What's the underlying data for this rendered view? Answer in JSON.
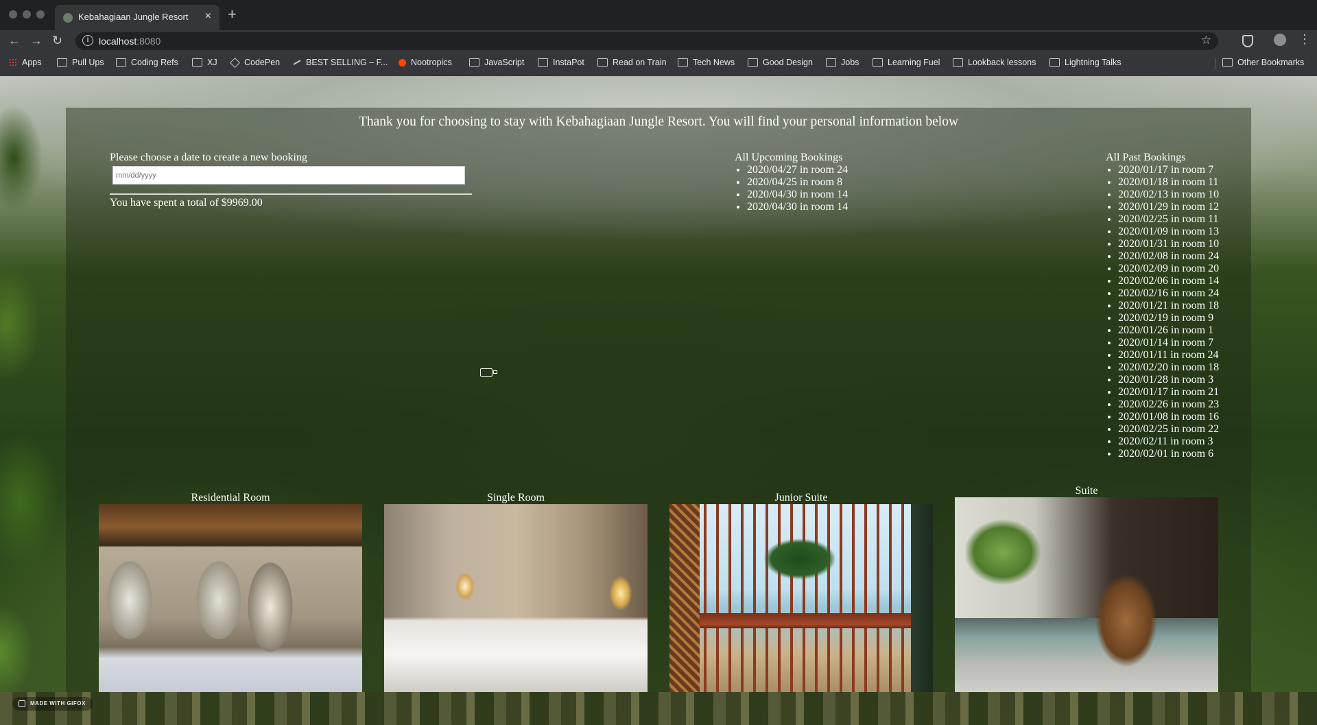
{
  "browser": {
    "tab_title": "Kebahagiaan Jungle Resort",
    "tab_close": "×",
    "new_tab": "+",
    "url_host": "localhost",
    "url_port": ":8080",
    "back": "←",
    "forward": "→",
    "reload": "↻",
    "star": "☆",
    "menu": "⋮",
    "info": "i"
  },
  "bookmarks": [
    {
      "label": "Apps",
      "icon": "apps-grid-icon"
    },
    {
      "label": "Pull Ups",
      "icon": "folder-icon"
    },
    {
      "label": "Coding Refs",
      "icon": "folder-icon"
    },
    {
      "label": "XJ",
      "icon": "folder-icon"
    },
    {
      "label": "CodePen",
      "icon": "codepen-icon"
    },
    {
      "label": "BEST SELLING – F...",
      "icon": "pen-icon"
    },
    {
      "label": "Nootropics",
      "icon": "reddit-icon"
    },
    {
      "label": "JavaScript",
      "icon": "folder-icon"
    },
    {
      "label": "InstaPot",
      "icon": "folder-icon"
    },
    {
      "label": "Read on Train",
      "icon": "folder-icon"
    },
    {
      "label": "Tech News",
      "icon": "folder-icon"
    },
    {
      "label": "Good Design",
      "icon": "folder-icon"
    },
    {
      "label": "Jobs",
      "icon": "folder-icon"
    },
    {
      "label": "Learning Fuel",
      "icon": "folder-icon"
    },
    {
      "label": "Lookback lessons",
      "icon": "folder-icon"
    },
    {
      "label": "Lightning Talks",
      "icon": "folder-icon"
    }
  ],
  "other_bookmarks": "Other Bookmarks",
  "page": {
    "welcome": "Thank you for choosing to stay with Kebahagiaan Jungle Resort. You will find your personal information below",
    "date_label": "Please choose a date to create a new booking",
    "date_placeholder": "mm/dd/yyyy",
    "spent": "You have spent a total of $9969.00",
    "upcoming_heading": "All Upcoming Bookings",
    "upcoming": [
      "2020/04/27 in room 24",
      "2020/04/25 in room 8",
      "2020/04/30 in room 14",
      "2020/04/30 in room 14"
    ],
    "past_heading": "All Past Bookings",
    "past": [
      "2020/01/17 in room 7",
      "2020/01/18 in room 11",
      "2020/02/13 in room 10",
      "2020/01/29 in room 12",
      "2020/02/25 in room 11",
      "2020/01/09 in room 13",
      "2020/01/31 in room 10",
      "2020/02/08 in room 24",
      "2020/02/09 in room 20",
      "2020/02/06 in room 14",
      "2020/02/16 in room 24",
      "2020/01/21 in room 18",
      "2020/02/19 in room 9",
      "2020/01/26 in room 1",
      "2020/01/14 in room 7",
      "2020/01/11 in room 24",
      "2020/02/20 in room 18",
      "2020/01/28 in room 3",
      "2020/01/17 in room 21",
      "2020/02/26 in room 23",
      "2020/01/08 in room 16",
      "2020/02/25 in room 22",
      "2020/02/11 in room 3",
      "2020/02/01 in room 6"
    ],
    "rooms": [
      {
        "title": "Residential Room"
      },
      {
        "title": "Single Room"
      },
      {
        "title": "Junior Suite"
      },
      {
        "title": "Suite"
      }
    ]
  },
  "watermark": "MADE WITH GIFOX"
}
